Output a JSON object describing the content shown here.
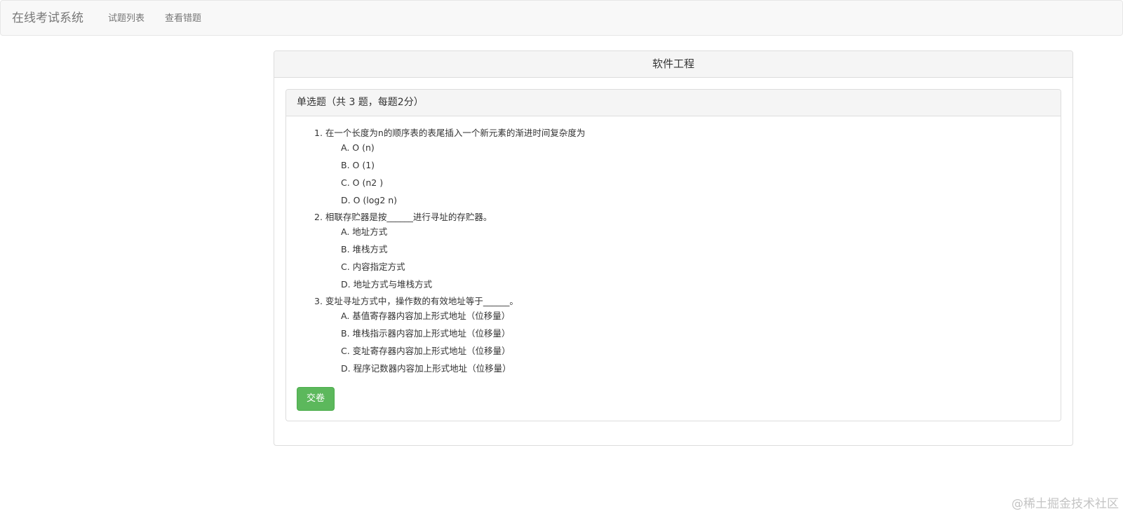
{
  "navbar": {
    "brand": "在线考试系统",
    "links": [
      "试题列表",
      "查看错题"
    ]
  },
  "exam": {
    "title": "软件工程",
    "section_title": "单选题（共 3 题，每题2分）",
    "questions": [
      {
        "title": "1. 在一个长度为n的顺序表的表尾插入一个新元素的渐进时间复杂度为",
        "options": [
          "A. O (n)",
          "B. O (1)",
          "C. O (n2 )",
          "D. O (log2 n)"
        ]
      },
      {
        "title": "2. 相联存贮器是按______进行寻址的存贮器。",
        "options": [
          "A. 地址方式",
          "B. 堆栈方式",
          "C. 内容指定方式",
          "D. 地址方式与堆栈方式"
        ]
      },
      {
        "title": "3. 变址寻址方式中，操作数的有效地址等于______。",
        "options": [
          "A. 基值寄存器内容加上形式地址（位移量）",
          "B. 堆栈指示器内容加上形式地址（位移量）",
          "C. 变址寄存器内容加上形式地址（位移量）",
          "D. 程序记数器内容加上形式地址（位移量）"
        ]
      }
    ],
    "submit_label": "交卷"
  },
  "watermark": "@稀土掘金技术社区",
  "colors": {
    "navbar_bg": "#f8f8f8",
    "panel_heading_bg": "#f5f5f5",
    "success": "#5cb85c",
    "border": "#dddddd"
  }
}
